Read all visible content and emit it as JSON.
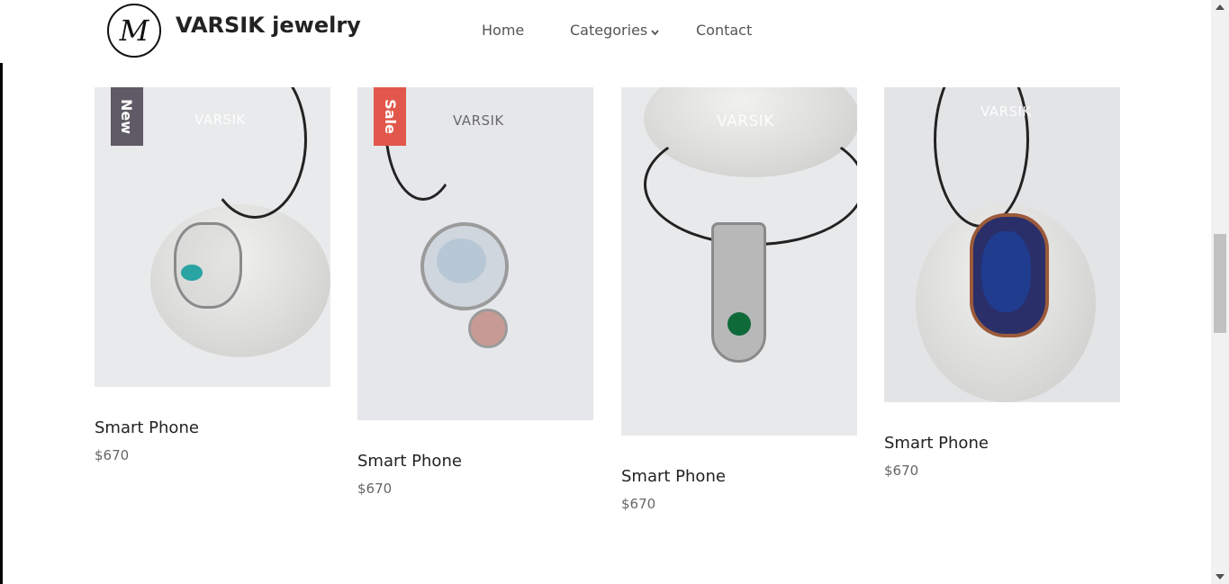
{
  "header": {
    "logo_mark": "M",
    "brand": "VARSIK jewelry",
    "nav": [
      {
        "label": "Home"
      },
      {
        "label": "Categories"
      },
      {
        "label": "Contact"
      }
    ]
  },
  "products": [
    {
      "title": "Smart Phone",
      "price": "$670",
      "badge": "New",
      "badge_color": "#5f5b66",
      "watermark": "VARSIK",
      "gem_color": "#2aa3a3"
    },
    {
      "title": "Smart Phone",
      "price": "$670",
      "badge": "Sale",
      "badge_color": "#e2574c",
      "watermark": "VARSIK",
      "gem_color": "#b7c7d6"
    },
    {
      "title": "Smart Phone",
      "price": "$670",
      "badge": "",
      "badge_color": "",
      "watermark": "VARSIK",
      "gem_color": "#0f6a3a"
    },
    {
      "title": "Smart Phone",
      "price": "$670",
      "badge": "",
      "badge_color": "",
      "watermark": "VARSIK",
      "gem_color": "#1f3c8f"
    }
  ],
  "colors": {
    "text": "#222222",
    "muted": "#666666",
    "sale": "#e2574c",
    "new": "#5f5b66"
  }
}
